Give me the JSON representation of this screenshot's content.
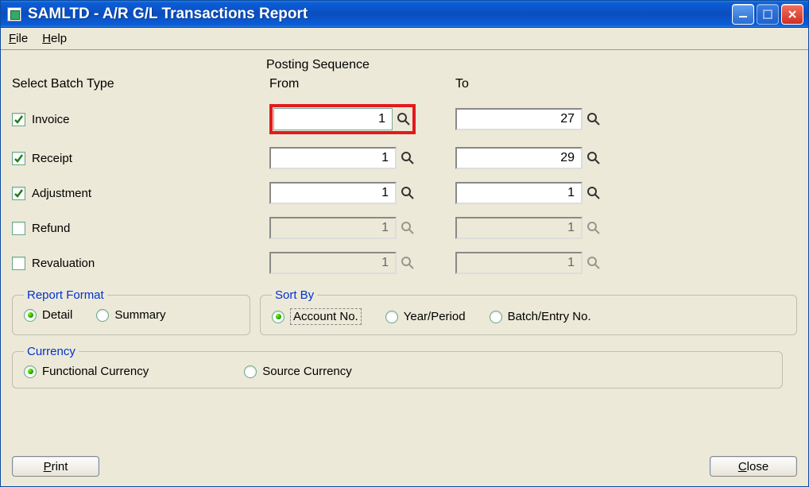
{
  "window": {
    "title": "SAMLTD - A/R G/L Transactions Report"
  },
  "menu": {
    "file": "File",
    "help": "Help"
  },
  "labels": {
    "posting_sequence": "Posting Sequence",
    "select_batch_type": "Select Batch Type",
    "from": "From",
    "to": "To"
  },
  "batch_rows": [
    {
      "key": "invoice",
      "label": "Invoice",
      "checked": true,
      "from": "1",
      "to": "27",
      "enabled": true
    },
    {
      "key": "receipt",
      "label": "Receipt",
      "checked": true,
      "from": "1",
      "to": "29",
      "enabled": true
    },
    {
      "key": "adjustment",
      "label": "Adjustment",
      "checked": true,
      "from": "1",
      "to": "1",
      "enabled": true
    },
    {
      "key": "refund",
      "label": "Refund",
      "checked": false,
      "from": "1",
      "to": "1",
      "enabled": false
    },
    {
      "key": "revaluation",
      "label": "Revaluation",
      "checked": false,
      "from": "1",
      "to": "1",
      "enabled": false
    }
  ],
  "report_format": {
    "legend": "Report Format",
    "options": {
      "detail": "Detail",
      "summary": "Summary"
    },
    "selected": "detail"
  },
  "sort_by": {
    "legend": "Sort By",
    "options": {
      "account": "Account No.",
      "year": "Year/Period",
      "batch": "Batch/Entry No."
    },
    "selected": "account"
  },
  "currency": {
    "legend": "Currency",
    "options": {
      "functional": "Functional Currency",
      "source": "Source Currency"
    },
    "selected": "functional"
  },
  "buttons": {
    "print": "Print",
    "close": "Close"
  }
}
